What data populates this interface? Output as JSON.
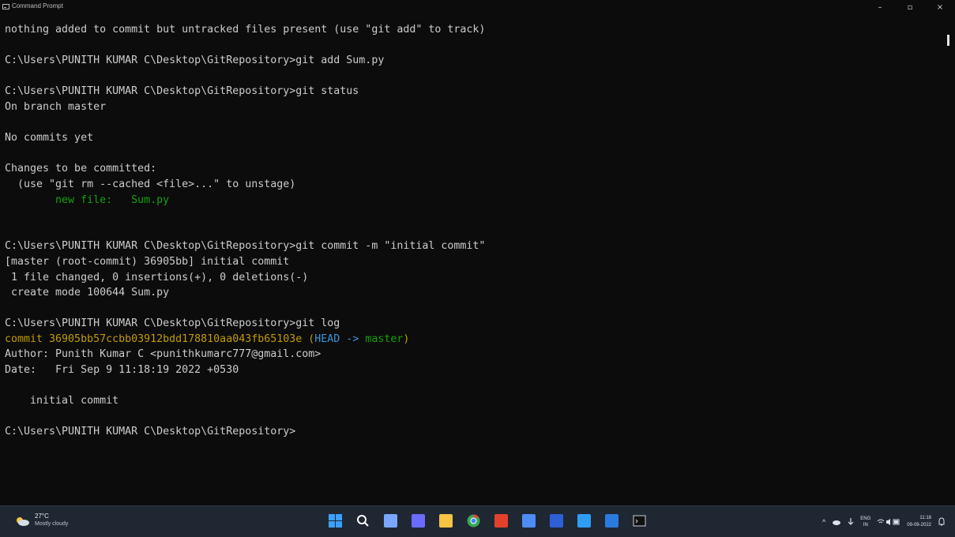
{
  "window": {
    "title": "Command Prompt",
    "controls": {
      "minimize": "–",
      "maximize": "▫",
      "close": "×"
    }
  },
  "console": {
    "lines": [
      "nothing added to commit but untracked files present (use \"git add\" to track)",
      "",
      "C:\\Users\\PUNITH KUMAR C\\Desktop\\GitRepository>git add Sum.py",
      "",
      "C:\\Users\\PUNITH KUMAR C\\Desktop\\GitRepository>git status",
      "On branch master",
      "",
      "No commits yet",
      "",
      "Changes to be committed:",
      "  (use \"git rm --cached <file>...\" to unstage)",
      "        new file:   Sum.py",
      "",
      "",
      "C:\\Users\\PUNITH KUMAR C\\Desktop\\GitRepository>git commit -m \"initial commit\"",
      "[master (root-commit) 36905bb] initial commit",
      " 1 file changed, 0 insertions(+), 0 deletions(-)",
      " create mode 100644 Sum.py",
      "",
      "C:\\Users\\PUNITH KUMAR C\\Desktop\\GitRepository>git log",
      "LOG_COMMIT_LINE",
      "Author: Punith Kumar C <punithkumarc777@gmail.com>",
      "Date:   Fri Sep 9 11:18:19 2022 +0530",
      "",
      "    initial commit",
      "",
      "C:\\Users\\PUNITH KUMAR C\\Desktop\\GitRepository>"
    ],
    "staged_file_line": "        new file:   Sum.py",
    "log_commit": {
      "prefix": "commit 36905bb57ccbb03912bdd178810aa043fb65103e ",
      "open_paren": "(",
      "head": "HEAD -> ",
      "branch": "master",
      "close_paren": ")"
    }
  },
  "taskbar": {
    "weather": {
      "temperature": "27°C",
      "condition": "Mostly cloudy"
    },
    "apps": [
      {
        "icon": "windows-start-icon",
        "color": "#3aa0ff"
      },
      {
        "icon": "search-icon",
        "color": "#ffffff"
      },
      {
        "icon": "task-view-icon",
        "color": "#7aa6ff"
      },
      {
        "icon": "chat-icon",
        "color": "#6b6bff"
      },
      {
        "icon": "file-explorer-icon",
        "color": "#f6c343"
      },
      {
        "icon": "chrome-icon",
        "color": "#e94b3c"
      },
      {
        "icon": "office-icon",
        "color": "#e3412c"
      },
      {
        "icon": "store-icon",
        "color": "#4c8cf5"
      },
      {
        "icon": "photoshop-icon",
        "color": "#2d5fd6"
      },
      {
        "icon": "vscode-icon",
        "color": "#2f9df4"
      },
      {
        "icon": "outlook-icon",
        "color": "#2a7bde"
      },
      {
        "icon": "terminal-icon",
        "color": "#cfcfcf"
      }
    ],
    "tray": {
      "chevron": "^",
      "language_top": "ENG",
      "language_bottom": "IN",
      "time": "11:18",
      "date": "09-09-2022"
    }
  },
  "colors": {
    "background": "#0c0c0c",
    "text": "#cccccc",
    "green": "#13a10e",
    "yellow": "#c19c00",
    "cyan": "#3a96dd",
    "taskbar": "#1f2733"
  }
}
